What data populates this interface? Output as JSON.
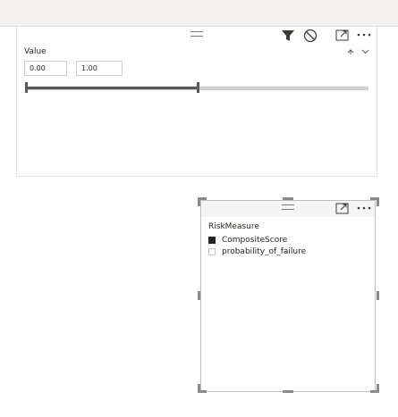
{
  "slicer_value": {
    "title": "Value",
    "min_value": "0.00",
    "max_value": "1.00",
    "range_fraction": [
      0,
      0.5
    ]
  },
  "slicer_risk": {
    "title": "RiskMeasure",
    "items": [
      {
        "label": "CompositeScore",
        "checked": true
      },
      {
        "label": "probability_of_failure",
        "checked": false
      }
    ]
  },
  "colors": {
    "slider_fill": "#5b5b5b",
    "checkbox_checked": "#252423",
    "selection_border": "#bfbfbf"
  }
}
